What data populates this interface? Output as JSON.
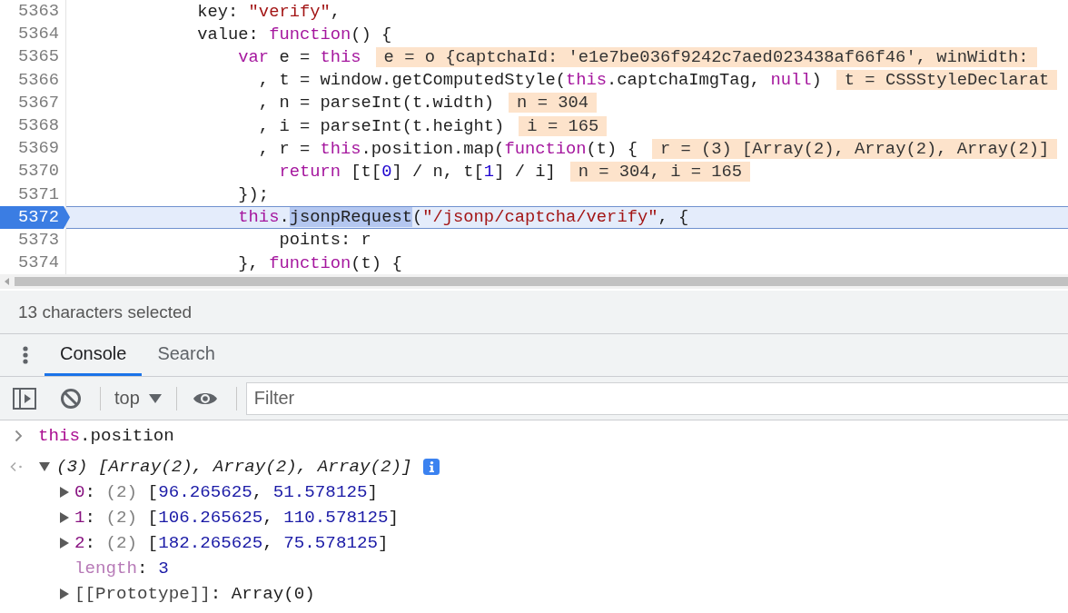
{
  "source": {
    "lines": [
      {
        "number": "5363",
        "kind": "statement",
        "current": false,
        "tokens": [
          {
            "kind": "plain",
            "text": "key: "
          },
          {
            "kind": "string",
            "text": "\"verify\""
          },
          {
            "kind": "plain",
            "text": ","
          }
        ]
      },
      {
        "number": "5364",
        "kind": "statement",
        "current": false,
        "tokens": [
          {
            "kind": "plain",
            "text": "value: "
          },
          {
            "kind": "keyword",
            "text": "function"
          },
          {
            "kind": "plain",
            "text": "() {"
          }
        ],
        "children": [
          {
            "number": "5365",
            "kind": "statement",
            "current": false,
            "tokens": [
              {
                "kind": "keyword",
                "text": "var"
              },
              {
                "kind": "plain",
                "text": " e = "
              },
              {
                "kind": "keyword",
                "text": "this"
              }
            ],
            "inline_value": "e = o {captchaId: 'e1e7be036f9242c7aed023438af66f46', winWidth:",
            "children": [
              {
                "number": "5366",
                "kind": "continuation",
                "current": false,
                "tokens": [
                  {
                    "kind": "plain",
                    "text": ", t = window.getComputedStyle("
                  },
                  {
                    "kind": "keyword",
                    "text": "this"
                  },
                  {
                    "kind": "plain",
                    "text": ".captchaImgTag, "
                  },
                  {
                    "kind": "keyword",
                    "text": "null"
                  },
                  {
                    "kind": "plain",
                    "text": ")"
                  }
                ],
                "inline_value": "t = CSSStyleDeclarat"
              },
              {
                "number": "5367",
                "kind": "continuation",
                "current": false,
                "tokens": [
                  {
                    "kind": "plain",
                    "text": ", n = parseInt(t.width)"
                  }
                ],
                "inline_value": "n = 304"
              },
              {
                "number": "5368",
                "kind": "continuation",
                "current": false,
                "tokens": [
                  {
                    "kind": "plain",
                    "text": ", i = parseInt(t.height)"
                  }
                ],
                "inline_value": "i = 165"
              },
              {
                "number": "5369",
                "kind": "continuation",
                "current": false,
                "tokens": [
                  {
                    "kind": "plain",
                    "text": ", r = "
                  },
                  {
                    "kind": "keyword",
                    "text": "this"
                  },
                  {
                    "kind": "plain",
                    "text": ".position.map("
                  },
                  {
                    "kind": "keyword",
                    "text": "function"
                  },
                  {
                    "kind": "plain",
                    "text": "(t) {"
                  }
                ],
                "inline_value": "r = (3) [Array(2), Array(2), Array(2)]"
              },
              {
                "number": "5370",
                "kind": "statement",
                "current": false,
                "tokens": [
                  {
                    "kind": "keyword",
                    "text": "return"
                  },
                  {
                    "kind": "plain",
                    "text": " [t["
                  },
                  {
                    "kind": "number",
                    "text": "0"
                  },
                  {
                    "kind": "plain",
                    "text": "] / n, t["
                  },
                  {
                    "kind": "number",
                    "text": "1"
                  },
                  {
                    "kind": "plain",
                    "text": "] / i]"
                  }
                ],
                "inline_value": "n = 304, i = 165"
              }
            ]
          },
          {
            "number": "5371",
            "kind": "statement",
            "current": false,
            "tokens": [
              {
                "kind": "plain",
                "text": "});"
              }
            ]
          },
          {
            "number": "5372",
            "kind": "statement",
            "current": true,
            "tokens": [
              {
                "kind": "keyword",
                "text": "this"
              },
              {
                "kind": "plain",
                "text": "."
              },
              {
                "kind": "selection",
                "text": "jsonpRequest"
              },
              {
                "kind": "plain",
                "text": "("
              },
              {
                "kind": "string",
                "text": "\"/jsonp/captcha/verify\""
              },
              {
                "kind": "plain",
                "text": ", {"
              }
            ],
            "children": [
              {
                "number": "5373",
                "kind": "statement",
                "current": false,
                "tokens": [
                  {
                    "kind": "plain",
                    "text": "points: r"
                  }
                ]
              }
            ]
          },
          {
            "number": "5374",
            "kind": "statement",
            "current": false,
            "tokens": [
              {
                "kind": "plain",
                "text": "}, "
              },
              {
                "kind": "keyword",
                "text": "function"
              },
              {
                "kind": "plain",
                "text": "(t) {"
              }
            ]
          }
        ]
      }
    ]
  },
  "status_bar": {
    "text": "13 characters selected"
  },
  "drawer": {
    "tabs": [
      {
        "label": "Console",
        "selected": true
      },
      {
        "label": "Search",
        "selected": false
      }
    ]
  },
  "console_toolbar": {
    "context": "top",
    "filter": {
      "placeholder": "Filter"
    }
  },
  "console": {
    "entries": [
      {
        "kind": "input",
        "tokens": [
          {
            "kind": "keyword",
            "text": "this"
          },
          {
            "kind": "plain",
            "text": ".position"
          }
        ]
      },
      {
        "kind": "result",
        "expanded": true,
        "summary": "(3) [Array(2), Array(2), Array(2)]",
        "children": [
          {
            "kind": "index",
            "key": "0",
            "expanded": false,
            "tokens": [
              {
                "kind": "plain",
                "text": ": "
              },
              {
                "kind": "muted",
                "text": "(2)"
              },
              {
                "kind": "plain",
                "text": " ["
              },
              {
                "kind": "number",
                "text": "96.265625"
              },
              {
                "kind": "plain",
                "text": ", "
              },
              {
                "kind": "number",
                "text": "51.578125"
              },
              {
                "kind": "plain",
                "text": "]"
              }
            ]
          },
          {
            "kind": "index",
            "key": "1",
            "expanded": false,
            "tokens": [
              {
                "kind": "plain",
                "text": ": "
              },
              {
                "kind": "muted",
                "text": "(2)"
              },
              {
                "kind": "plain",
                "text": " ["
              },
              {
                "kind": "number",
                "text": "106.265625"
              },
              {
                "kind": "plain",
                "text": ", "
              },
              {
                "kind": "number",
                "text": "110.578125"
              },
              {
                "kind": "plain",
                "text": "]"
              }
            ]
          },
          {
            "kind": "index",
            "key": "2",
            "expanded": false,
            "tokens": [
              {
                "kind": "plain",
                "text": ": "
              },
              {
                "kind": "muted",
                "text": "(2)"
              },
              {
                "kind": "plain",
                "text": " ["
              },
              {
                "kind": "number",
                "text": "182.265625"
              },
              {
                "kind": "plain",
                "text": ", "
              },
              {
                "kind": "number",
                "text": "75.578125"
              },
              {
                "kind": "plain",
                "text": "]"
              }
            ]
          },
          {
            "kind": "hidden",
            "key": "length",
            "tokens": [
              {
                "kind": "plain",
                "text": ": "
              },
              {
                "kind": "number",
                "text": "3"
              }
            ]
          },
          {
            "kind": "internal",
            "key": "[[Prototype]]",
            "expanded": false,
            "tokens": [
              {
                "kind": "plain",
                "text": ": Array(0)"
              }
            ]
          }
        ]
      }
    ]
  }
}
